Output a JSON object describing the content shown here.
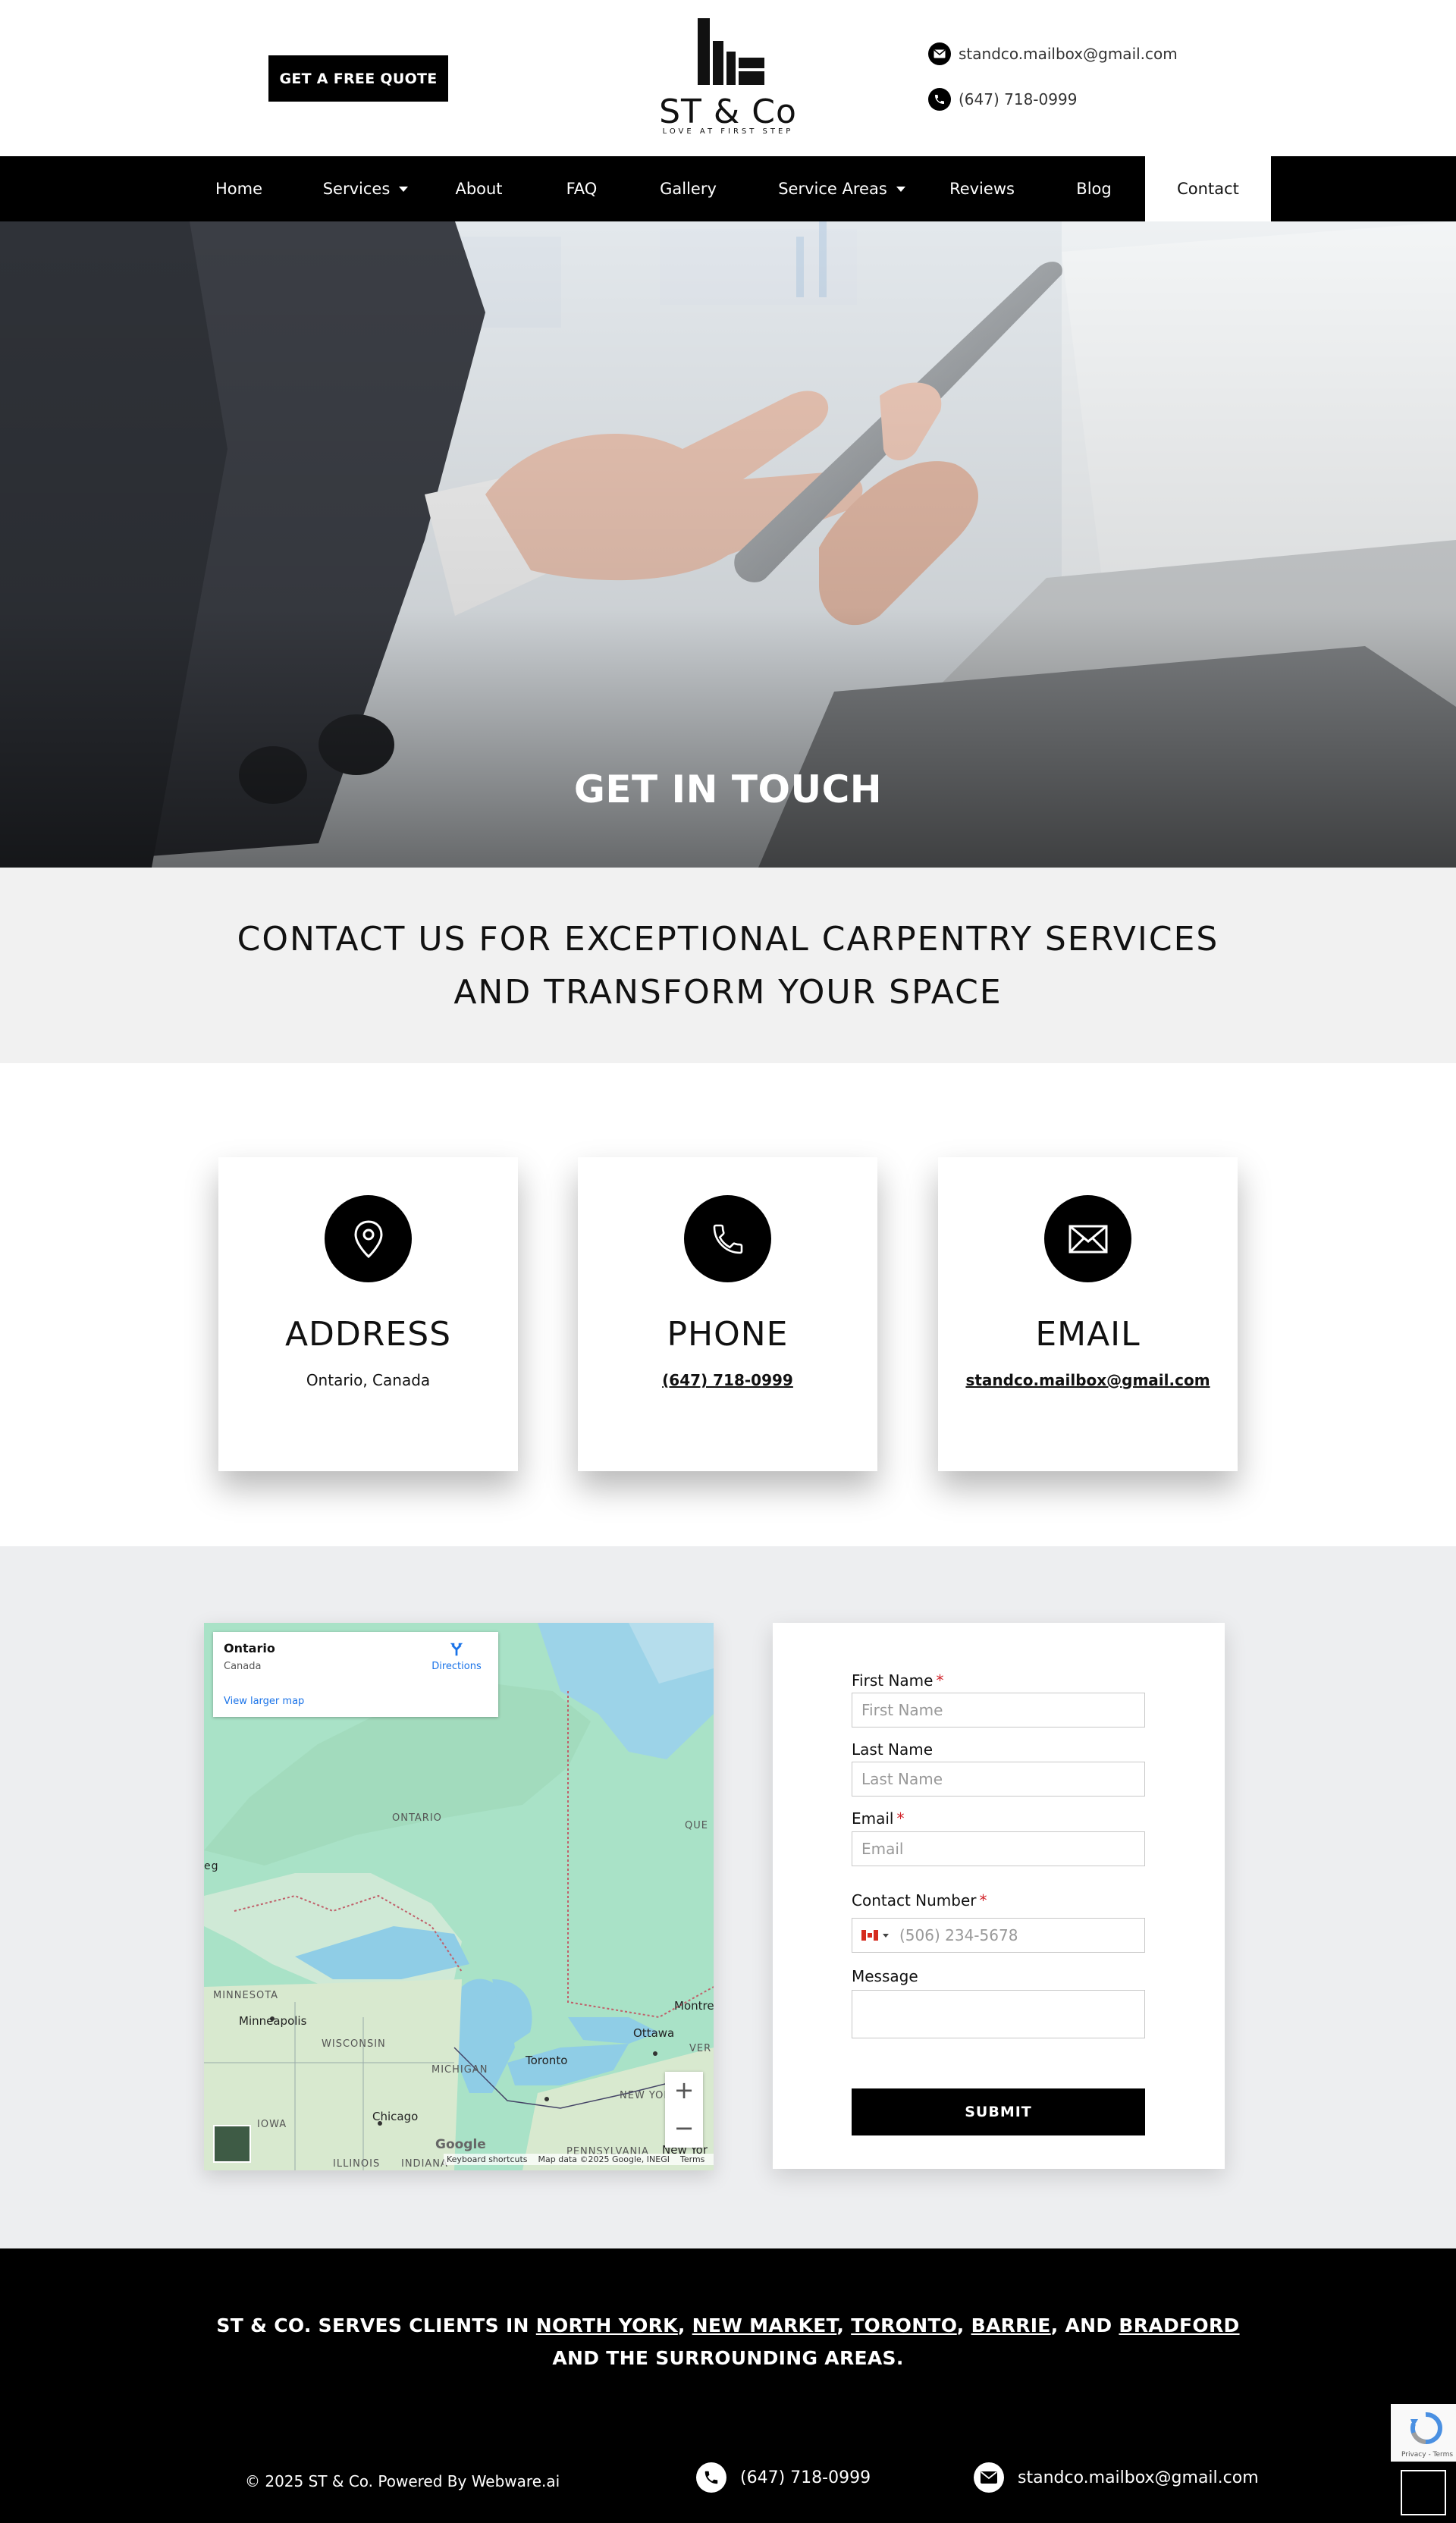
{
  "header": {
    "quote_button": "GET A FREE QUOTE",
    "logo_text": "ST & Co",
    "logo_tagline": "LOVE AT FIRST STEP",
    "email": "standco.mailbox@gmail.com",
    "phone": "(647) 718-0999"
  },
  "nav": {
    "items": [
      {
        "label": "Home"
      },
      {
        "label": "Services"
      },
      {
        "label": "About"
      },
      {
        "label": "FAQ"
      },
      {
        "label": "Gallery"
      },
      {
        "label": "Service Areas"
      },
      {
        "label": "Reviews"
      },
      {
        "label": "Blog"
      },
      {
        "label": "Contact"
      }
    ],
    "active": "Contact"
  },
  "hero": {
    "title": "GET IN TOUCH"
  },
  "intro": {
    "title": "CONTACT US FOR EXCEPTIONAL CARPENTRY SERVICES AND TRANSFORM YOUR SPACE"
  },
  "cards": [
    {
      "title": "ADDRESS",
      "value": "Ontario, Canada",
      "icon": "location-pin-icon"
    },
    {
      "title": "PHONE",
      "value": "(647) 718-0999",
      "icon": "phone-icon"
    },
    {
      "title": "EMAIL",
      "value": "standco.mailbox@gmail.com",
      "icon": "envelope-icon"
    }
  ],
  "map": {
    "place_name": "Ontario",
    "place_sub": "Canada",
    "directions": "Directions",
    "larger_map": "View larger map",
    "labels": [
      "ONTARIO",
      "QUE",
      "eg",
      "MINNESOTA",
      "WISCONSIN",
      "MICHIGAN",
      "IOWA",
      "NEW YOR",
      "PENNSYLVANIA",
      "VER",
      "ILLINOIS",
      "INDIANA"
    ],
    "cities": [
      "Minneapolis",
      "Toronto",
      "Ottawa",
      "Montre",
      "Chicago",
      "New Yor"
    ],
    "zoom_in": "+",
    "zoom_out": "−",
    "footer_shortcuts": "Keyboard shortcuts",
    "footer_data": "Map data ©2025 Google, INEGI",
    "footer_terms": "Terms",
    "google": "Google"
  },
  "form": {
    "first_name_label": "First Name",
    "first_name_placeholder": "First Name",
    "last_name_label": "Last Name",
    "last_name_placeholder": "Last Name",
    "email_label": "Email",
    "email_placeholder": "Email",
    "contact_label": "Contact Number",
    "contact_placeholder": "(506) 234-5678",
    "message_label": "Message",
    "required_mark": "*",
    "submit": "SUBMIT"
  },
  "footer": {
    "serve_prefix": "ST & CO. SERVES CLIENTS IN ",
    "areas": [
      "NORTH YORK",
      "NEW MARKET",
      "TORONTO",
      "BARRIE",
      "BRADFORD"
    ],
    "sep1": ", ",
    "sep2": ", ",
    "sep3": ", ",
    "sep4": ", AND ",
    "serve_suffix": " AND THE SURROUNDING AREAS.",
    "copyright": "© 2025 ST & Co. Powered By Webware.ai",
    "phone": "(647) 718-0999",
    "email": "standco.mailbox@gmail.com"
  },
  "recaptcha": {
    "text": "Privacy - Terms"
  },
  "colors": {
    "primary": "#000000",
    "required": "#d2232a",
    "map_link": "#1a73e8"
  }
}
